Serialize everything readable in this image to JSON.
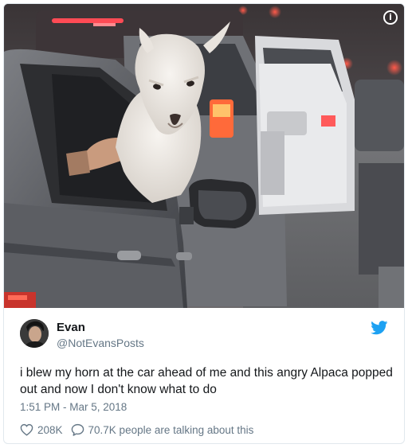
{
  "photo": {
    "subject": "alpaca",
    "info_icon": "info-icon"
  },
  "author": {
    "name": "Evan",
    "handle": "@NotEvansPosts",
    "avatar_icon": "avatar"
  },
  "tweet": {
    "text": "i blew my horn at the car ahead of me and this angry Alpaca popped out and now I don't know what to do",
    "timestamp": "1:51 PM - Mar 5, 2018"
  },
  "stats": {
    "likes": "208K",
    "talking": "70.7K people are talking about this"
  },
  "colors": {
    "twitter_blue": "#1da1f2",
    "meta_gray": "#657786",
    "text": "#14171a",
    "border": "#e1e8ed"
  }
}
